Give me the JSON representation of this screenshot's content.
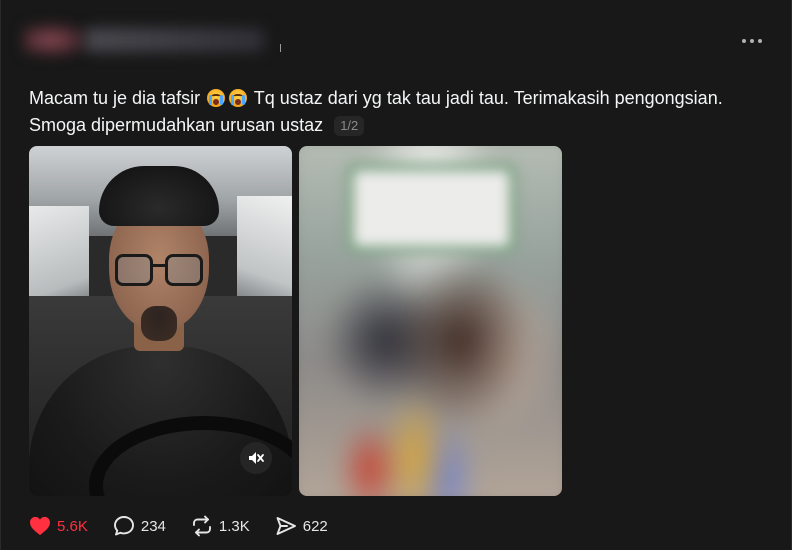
{
  "post": {
    "author_redacted": true,
    "caption_line1_part1": "Macam tu je dia tafsir",
    "caption_line1_part2": "Tq ustaz dari yg tak tau jadi tau. Terimakasih pengongsian.",
    "caption_line2": "Smoga dipermudahkan urusan ustaz",
    "media_counter": "1/2",
    "emojis": [
      "crying-face",
      "crying-face"
    ]
  },
  "actions": {
    "likes": "5.6K",
    "comments": "234",
    "reposts": "1.3K",
    "shares": "622"
  },
  "colors": {
    "background": "#181818",
    "text": "#f3f5f7",
    "like_active": "#ff3040",
    "muted": "#8a8a8a"
  },
  "icons": [
    "more-icon",
    "mute-icon",
    "heart-icon",
    "comment-icon",
    "repost-icon",
    "share-icon"
  ]
}
